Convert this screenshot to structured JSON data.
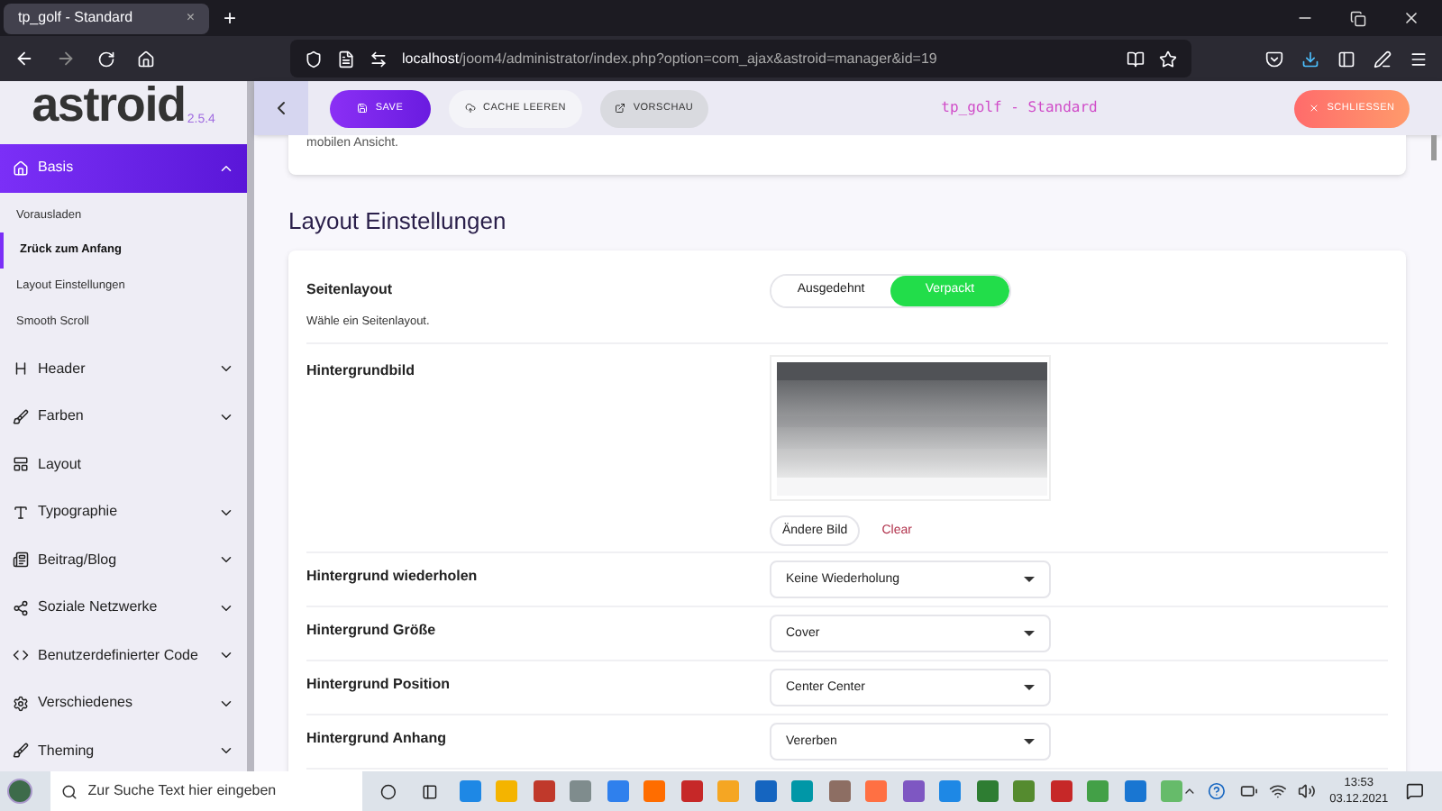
{
  "browser": {
    "tab": {
      "title": "tp_golf - Standard",
      "close": "×"
    },
    "new_tab": "+",
    "url_host": "localhost",
    "url_path": "/joom4/administrator/index.php?option=com_ajax&astroid=manager&id=19"
  },
  "sidebar": {
    "logo": "astroid",
    "version": "2.5.4",
    "items": [
      {
        "kind": "group",
        "label": "Basis",
        "selected": true,
        "expanded": true,
        "children": [
          {
            "label": "Vorausladen",
            "selected": false
          },
          {
            "label": "Zrück zum Anfang",
            "selected": true
          },
          {
            "label": "Layout Einstellungen",
            "selected": false
          },
          {
            "label": "Smooth Scroll",
            "selected": false
          }
        ]
      },
      {
        "kind": "group",
        "label": "Header",
        "selected": false,
        "expanded": false
      },
      {
        "kind": "group",
        "label": "Farben",
        "selected": false,
        "expanded": false
      },
      {
        "kind": "link",
        "label": "Layout",
        "selected": false
      },
      {
        "kind": "group",
        "label": "Typographie",
        "selected": false,
        "expanded": false
      },
      {
        "kind": "group",
        "label": "Beitrag/Blog",
        "selected": false,
        "expanded": false
      },
      {
        "kind": "group",
        "label": "Soziale Netzwerke",
        "selected": false,
        "expanded": false
      },
      {
        "kind": "group",
        "label": "Benutzerdefinierter Code",
        "selected": false,
        "expanded": false
      },
      {
        "kind": "group",
        "label": "Verschiedenes",
        "selected": false,
        "expanded": false
      },
      {
        "kind": "group",
        "label": "Theming",
        "selected": false,
        "expanded": false
      }
    ]
  },
  "toolbar": {
    "save": "SAVE",
    "cache": "CACHE LEEREN",
    "preview": "VORSCHAU",
    "title": "tp_golf - Standard",
    "close": "SCHLIESSEN"
  },
  "prev_card_text": "mobilen Ansicht.",
  "section": {
    "title": "Layout Einstellungen",
    "rows": [
      {
        "kind": "segmented",
        "label": "Seitenlayout",
        "help": "Wähle ein Seitenlayout.",
        "options": [
          {
            "label": "Ausgedehnt",
            "selected": false
          },
          {
            "label": "Verpackt",
            "selected": true
          }
        ]
      },
      {
        "label": "Hintergrundbild",
        "change": "Ändere Bild",
        "clear": "Clear"
      },
      {
        "kind": "select",
        "label": "Hintergrund wiederholen",
        "value": "Keine Wiederholung"
      },
      {
        "kind": "select",
        "label": "Hintergrund Größe",
        "value": "Cover"
      },
      {
        "kind": "select",
        "label": "Hintergrund Position",
        "value": "Center Center"
      },
      {
        "kind": "select",
        "label": "Hintergrund Anhang",
        "value": "Vererben"
      }
    ]
  },
  "taskbar": {
    "search_placeholder": "Zur Suche Text hier eingeben",
    "time": "13:53",
    "date": "03.12.2021"
  }
}
